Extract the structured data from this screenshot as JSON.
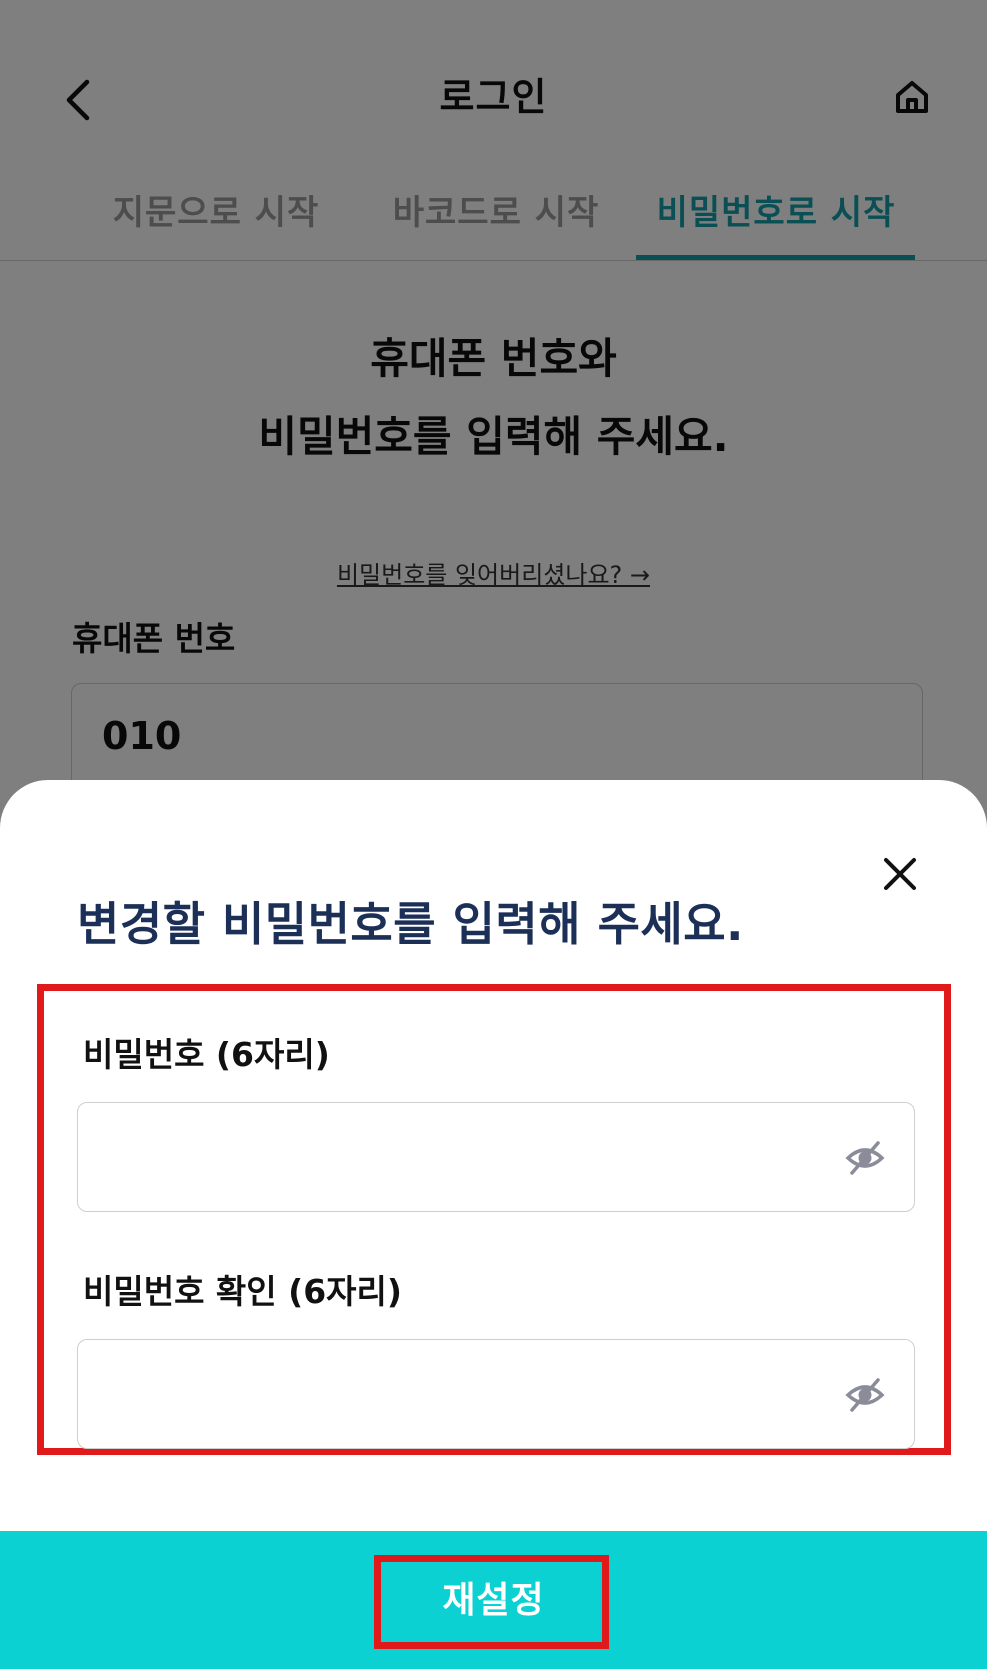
{
  "header": {
    "title": "로그인",
    "back_icon": "chevron-left-icon",
    "home_icon": "home-icon"
  },
  "tabs": [
    {
      "label": "지문으로 시작",
      "active": false
    },
    {
      "label": "바코드로 시작",
      "active": false
    },
    {
      "label": "비밀번호로 시작",
      "active": true
    }
  ],
  "login": {
    "headline_line1": "휴대폰 번호와",
    "headline_line2": "비밀번호를 입력해 주세요.",
    "forgot_link": "비밀번호를 잊어버리셨나요? →",
    "phone_label": "휴대폰 번호",
    "phone_value": "010"
  },
  "sheet": {
    "title": "변경할 비밀번호를 입력해 주세요.",
    "close_icon": "close-icon",
    "password_label": "비밀번호 (6자리)",
    "password_value": "",
    "confirm_label": "비밀번호 확인 (6자리)",
    "confirm_value": "",
    "eye_icon": "eye-off-icon",
    "reset_button": "재설정"
  },
  "colors": {
    "accent": "#139fa8",
    "title_navy": "#1b2f57",
    "button_bg": "#0bd1d3",
    "highlight_red": "#e0191b"
  }
}
